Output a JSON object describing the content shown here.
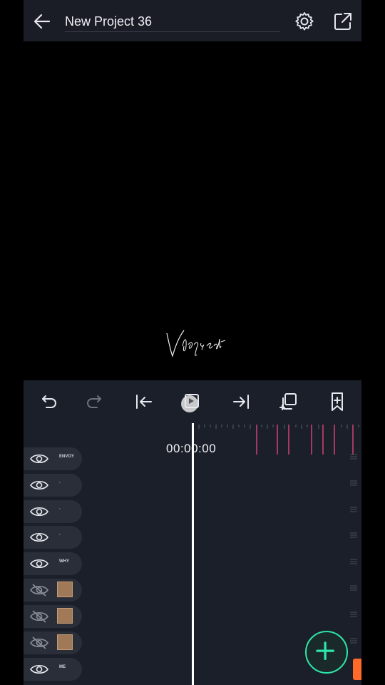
{
  "header": {
    "title": "New Project 36",
    "icons": [
      "back-arrow-icon",
      "gear-icon",
      "share-export-icon"
    ]
  },
  "preview": {
    "watermark_text": "Vlogs edit"
  },
  "toolbar": {
    "icons": [
      "undo-icon",
      "redo-icon",
      "jump-to-start-icon",
      "loop-play-icon",
      "jump-to-end-icon",
      "duplicate-icon",
      "bookmark-add-icon"
    ]
  },
  "timeline": {
    "time_display": "00:00:00"
  },
  "layers": [
    {
      "label": "ENVOY",
      "visible": true,
      "type": "text"
    },
    {
      "label": "·",
      "visible": true,
      "type": "text"
    },
    {
      "label": "·",
      "visible": true,
      "type": "text"
    },
    {
      "label": "·",
      "visible": true,
      "type": "text"
    },
    {
      "label": "WHY",
      "visible": true,
      "type": "text"
    },
    {
      "label": "",
      "visible": false,
      "type": "image"
    },
    {
      "label": "",
      "visible": false,
      "type": "image"
    },
    {
      "label": "",
      "visible": false,
      "type": "image"
    },
    {
      "label": "ME",
      "visible": true,
      "type": "text"
    }
  ],
  "colors": {
    "accent": "#2ee6a8",
    "marker": "#ff4d8a",
    "playhead": "#ffffff",
    "panel": "#1b1f29"
  }
}
